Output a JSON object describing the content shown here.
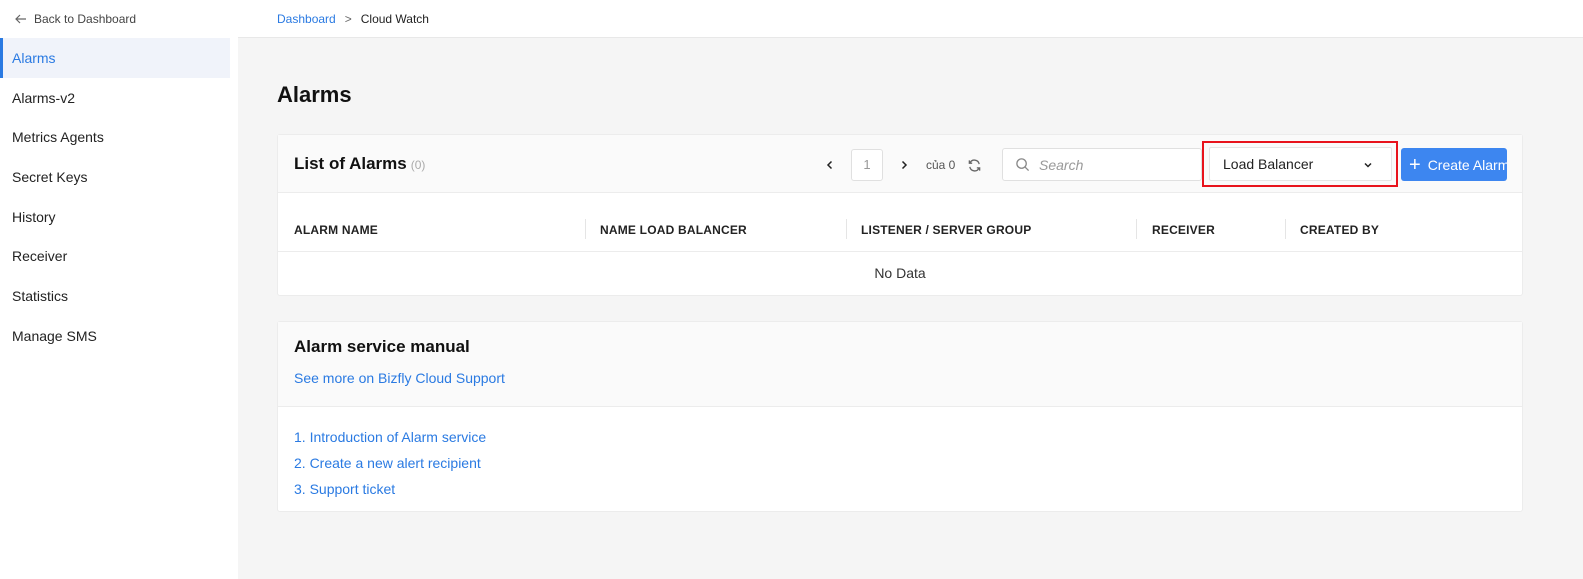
{
  "sidebar": {
    "back_label": "Back to Dashboard",
    "items": [
      {
        "label": "Alarms",
        "active": true
      },
      {
        "label": "Alarms-v2"
      },
      {
        "label": "Metrics Agents"
      },
      {
        "label": "Secret Keys"
      },
      {
        "label": "History"
      },
      {
        "label": "Receiver"
      },
      {
        "label": "Statistics"
      },
      {
        "label": "Manage SMS"
      }
    ]
  },
  "breadcrumb": {
    "root": "Dashboard",
    "separator": ">",
    "current": "Cloud Watch"
  },
  "page": {
    "title": "Alarms"
  },
  "alarms": {
    "title": "List of Alarms",
    "count": "(0)",
    "pager": {
      "page": "1",
      "of_label": "của 0"
    },
    "search_placeholder": "Search",
    "filter_selected": "Load Balancer",
    "create_label": "Create Alarm",
    "columns": [
      "ALARM NAME",
      "NAME LOAD BALANCER",
      "LISTENER / SERVER GROUP",
      "RECEIVER",
      "CREATED BY"
    ],
    "empty": "No Data"
  },
  "manual": {
    "title": "Alarm service manual",
    "support_link": "See more on Bizfly Cloud Support",
    "links": [
      "1. Introduction of Alarm service",
      "2. Create a new alert recipient",
      "3. Support ticket"
    ]
  },
  "colors": {
    "accent": "#2a7ae2",
    "button": "#3d86f0",
    "highlight_border": "#e8131c"
  },
  "icons": [
    "arrow-left-icon",
    "chevron-left-icon",
    "chevron-right-icon",
    "refresh-icon",
    "search-icon",
    "chevron-down-icon",
    "plus-icon"
  ]
}
